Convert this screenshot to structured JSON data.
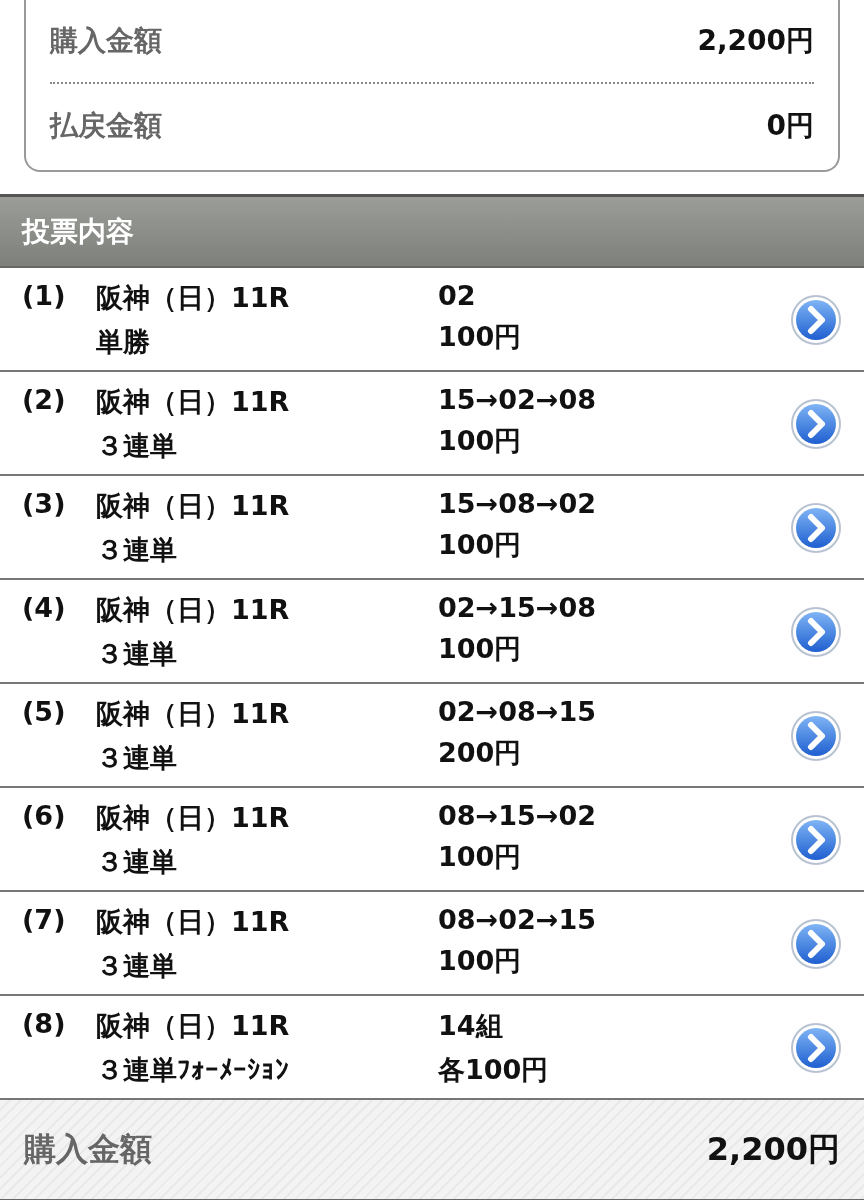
{
  "summary": {
    "rows": [
      {
        "label": "購入金額",
        "value": "2,200円"
      },
      {
        "label": "払戻金額",
        "value": "0円"
      }
    ]
  },
  "section": {
    "title": "投票内容"
  },
  "bets": [
    {
      "index": "(1)",
      "race": "阪神（日）11R",
      "type": "単勝",
      "combo": "02",
      "amount": "100円"
    },
    {
      "index": "(2)",
      "race": "阪神（日）11R",
      "type": "３連単",
      "combo": "15→02→08",
      "amount": "100円"
    },
    {
      "index": "(3)",
      "race": "阪神（日）11R",
      "type": "３連単",
      "combo": "15→08→02",
      "amount": "100円"
    },
    {
      "index": "(4)",
      "race": "阪神（日）11R",
      "type": "３連単",
      "combo": "02→15→08",
      "amount": "100円"
    },
    {
      "index": "(5)",
      "race": "阪神（日）11R",
      "type": "３連単",
      "combo": "02→08→15",
      "amount": "200円"
    },
    {
      "index": "(6)",
      "race": "阪神（日）11R",
      "type": "３連単",
      "combo": "08→15→02",
      "amount": "100円"
    },
    {
      "index": "(7)",
      "race": "阪神（日）11R",
      "type": "３連単",
      "combo": "08→02→15",
      "amount": "100円"
    },
    {
      "index": "(8)",
      "race": "阪神（日）11R",
      "type": "３連単ﾌｫｰﾒｰｼｮﾝ",
      "combo": "14組",
      "amount": "各100円"
    }
  ],
  "footer": {
    "label": "購入金額",
    "value": "2,200円"
  }
}
